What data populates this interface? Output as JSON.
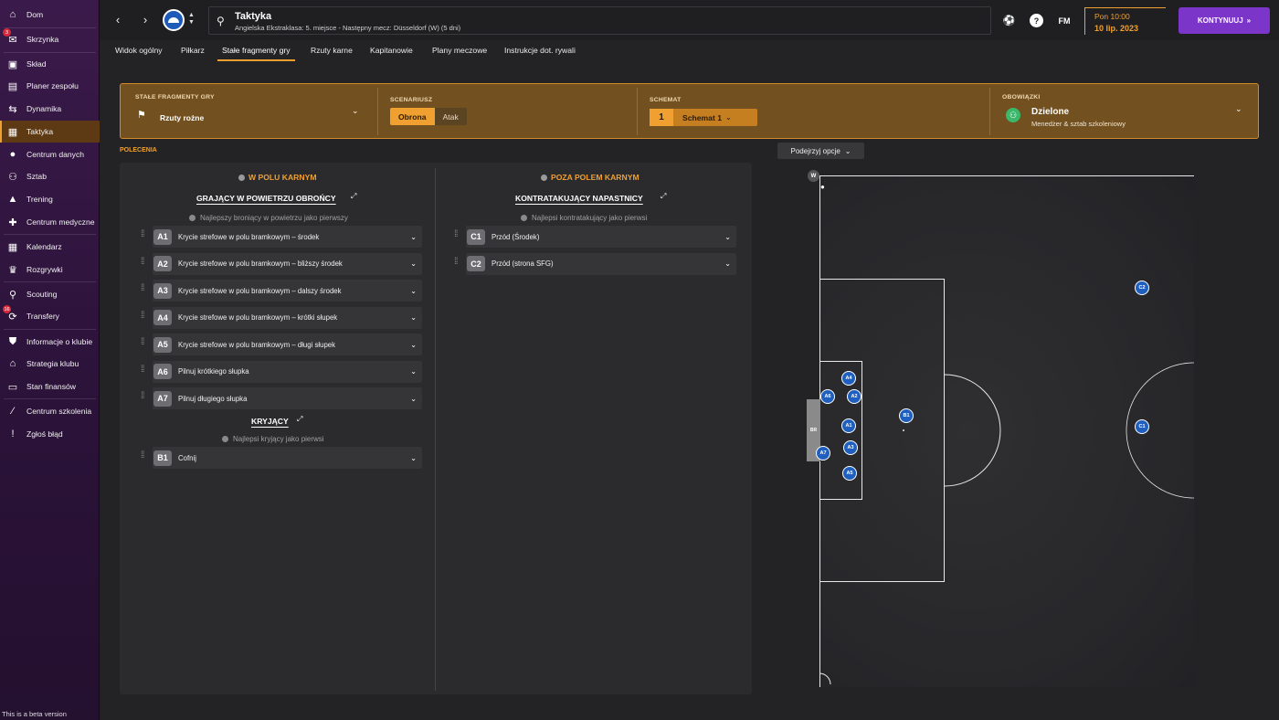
{
  "sidebar": {
    "items": [
      {
        "label": "Dom",
        "icon": "home-icon"
      },
      {
        "label": "Skrzynka",
        "icon": "inbox-icon",
        "badge": "3"
      },
      {
        "label": "Skład",
        "icon": "shirt-icon"
      },
      {
        "label": "Planer zespołu",
        "icon": "clipboard-icon"
      },
      {
        "label": "Dynamika",
        "icon": "dynamics-icon"
      },
      {
        "label": "Taktyka",
        "icon": "tactics-icon",
        "active": true
      },
      {
        "label": "Centrum danych",
        "icon": "data-icon"
      },
      {
        "label": "Sztab",
        "icon": "staff-icon"
      },
      {
        "label": "Trening",
        "icon": "training-icon"
      },
      {
        "label": "Centrum medyczne",
        "icon": "medical-icon"
      },
      {
        "label": "Kalendarz",
        "icon": "calendar-icon"
      },
      {
        "label": "Rozgrywki",
        "icon": "trophy-icon"
      },
      {
        "label": "Scouting",
        "icon": "scouting-icon"
      },
      {
        "label": "Transfery",
        "icon": "transfers-icon",
        "badge": "16"
      },
      {
        "label": "Informacje o klubie",
        "icon": "club-info-icon"
      },
      {
        "label": "Strategia klubu",
        "icon": "strategy-icon"
      },
      {
        "label": "Stan finansów",
        "icon": "finances-icon"
      },
      {
        "label": "Centrum szkolenia",
        "icon": "academy-icon"
      },
      {
        "label": "Zgłoś błąd",
        "icon": "bug-report-icon"
      }
    ],
    "beta_note": "This is a beta version"
  },
  "header": {
    "title": "Taktyka",
    "subtitle": "Angielska Ekstraklasa: 5. miejsce - Następny mecz: Düsseldorf (W) (5 dni)",
    "fm_label": "FM",
    "date_line1": "Pon 10:00",
    "date_line2": "10 lip. 2023",
    "continue_label": "KONTYNUUJ"
  },
  "tabs": [
    "Widok ogólny",
    "Piłkarz",
    "Stałe fragmenty gry",
    "Rzuty karne",
    "Kapitanowie",
    "Plany meczowe",
    "Instrukcje dot. rywali"
  ],
  "setpieces": {
    "type_label": "STAŁE FRAGMENTY GRY",
    "type_value": "Rzuty rożne",
    "scenario_label": "SCENARIUSZ",
    "scenario_options": [
      "Obrona",
      "Atak"
    ],
    "scenario_selected": "Obrona",
    "scheme_label": "SCHEMAT",
    "scheme_number": "1",
    "scheme_value": "Schemat 1",
    "duties_label": "OBOWIĄZKI",
    "duties_value": "Dzielone",
    "duties_sub": "Menedżer & sztab szkoleniowy"
  },
  "instructions": {
    "heading": "POLECENIA",
    "left": {
      "title": "W POLU KARNYM",
      "group1": "GRAJĄCY W POWIETRZU OBROŃCY",
      "group1_hint": "Najlepszy broniący w powietrzu jako pierwszy",
      "rows": [
        {
          "code": "A1",
          "text": "Krycie strefowe w polu bramkowym – środek"
        },
        {
          "code": "A2",
          "text": "Krycie strefowe w polu bramkowym – bliższy środek"
        },
        {
          "code": "A3",
          "text": "Krycie strefowe w polu bramkowym – dalszy środek"
        },
        {
          "code": "A4",
          "text": "Krycie strefowe w polu bramkowym – krótki słupek"
        },
        {
          "code": "A5",
          "text": "Krycie strefowe w polu bramkowym – długi słupek"
        },
        {
          "code": "A6",
          "text": "Pilnuj krótkiego słupka"
        },
        {
          "code": "A7",
          "text": "Pilnuj długiego słupka"
        }
      ],
      "group2": "KRYJĄCY",
      "group2_hint": "Najlepsi kryjący jako pierwsi",
      "rows2": [
        {
          "code": "B1",
          "text": "Cofnij"
        }
      ]
    },
    "right": {
      "title": "POZA POLEM KARNYM",
      "group1": "KONTRATAKUJĄCY NAPASTNICY",
      "group1_hint": "Najlepsi kontratakujący jako pierwsi",
      "rows": [
        {
          "code": "C1",
          "text": "Przód (Środek)"
        },
        {
          "code": "C2",
          "text": "Przód (strona SFG)"
        }
      ]
    }
  },
  "pitch": {
    "preview_label": "Podejrzyj opcje",
    "corner_tag": "W",
    "goal_label": "BR",
    "players": [
      "A4",
      "A6",
      "A2",
      "A1",
      "A3",
      "A7",
      "A5",
      "B1",
      "C1",
      "C2"
    ]
  },
  "colors": {
    "accent": "#f0a030",
    "continue": "#7b35c9",
    "player": "#1f5fbf"
  }
}
